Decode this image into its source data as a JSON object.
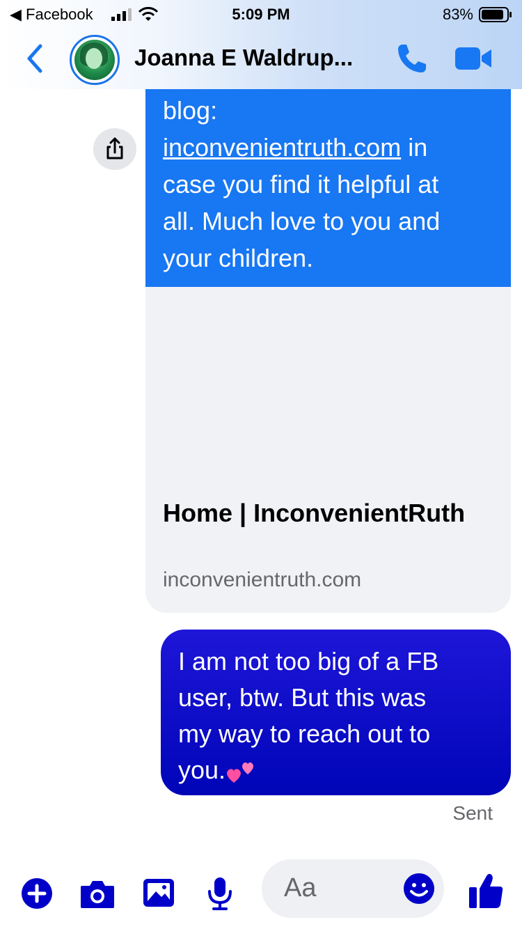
{
  "status_bar": {
    "back_app": "◀ Facebook",
    "time": "5:09 PM",
    "battery_percent": "83%"
  },
  "header": {
    "contact_name": "Joanna E Waldrup..."
  },
  "messages": {
    "received": {
      "line_partial": "blog:",
      "link_text": "inconvenientruth.com",
      "after_link": " in",
      "line3": "case you find it helpful at",
      "line4": "all. Much  love to you and",
      "line5": "your  children."
    },
    "link_preview": {
      "title": "Home | InconvenientRuth",
      "domain": "inconvenientruth.com"
    },
    "sent": {
      "line1": "I am not too big of a FB",
      "line2": "user, btw. But this was",
      "line3": "my way to reach  out to",
      "line4": "you."
    },
    "sent_status": "Sent"
  },
  "composer": {
    "placeholder": "Aa"
  },
  "colors": {
    "accent": "#1877f2",
    "sent_bubble": "#0005b8",
    "toolbar_icons": "#0000c8"
  }
}
